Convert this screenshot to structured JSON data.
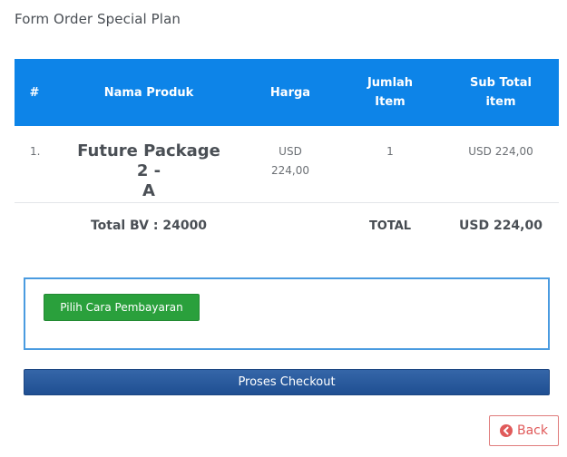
{
  "page": {
    "title": "Form Order Special Plan"
  },
  "table": {
    "headers": {
      "no": "#",
      "name": "Nama Produk",
      "price": "Harga",
      "qty_line1": "Jumlah",
      "qty_line2": "Item",
      "sub_line1": "Sub Total",
      "sub_line2": "item"
    },
    "rows": [
      {
        "no": "1.",
        "name_line1": "Future Package 2 -",
        "name_line2": "A",
        "price_line1": "USD",
        "price_line2": "224,00",
        "qty": "1",
        "subtotal": "USD 224,00"
      }
    ],
    "totals": {
      "bv": "Total BV : 24000",
      "label": "TOTAL",
      "value": "USD 224,00"
    }
  },
  "payment": {
    "choose_label": "Pilih Cara Pembayaran"
  },
  "checkout": {
    "label": "Proses Checkout"
  },
  "back": {
    "label": "Back",
    "icon": "circle-arrow-left-icon"
  },
  "colors": {
    "header_bg": "#0d84e8",
    "pay_button": "#2aa03c",
    "checkout_button": "#1f4f92",
    "back_button": "#e05a5a",
    "payment_border": "#4a9be0"
  }
}
